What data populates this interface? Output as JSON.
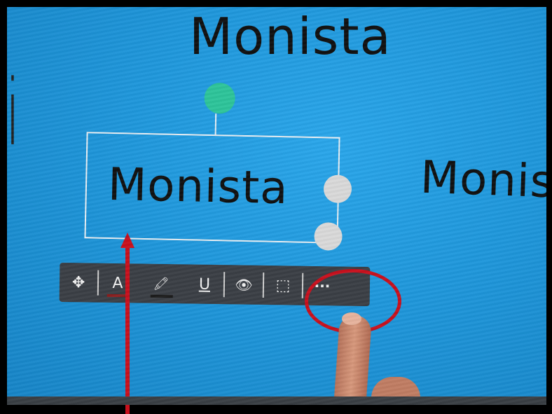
{
  "canvas_words": {
    "top": "Monista",
    "left_fragment": "i",
    "right": "Monis"
  },
  "selected_text": "Monista",
  "toolbar": {
    "buttons": [
      {
        "name": "move",
        "icon": "✥"
      },
      {
        "name": "text-color",
        "icon": "A"
      },
      {
        "name": "highlight",
        "icon": "🖍"
      },
      {
        "name": "underline",
        "icon": "U"
      },
      {
        "name": "visibility",
        "icon": "👁"
      },
      {
        "name": "crop",
        "icon": "⬚"
      },
      {
        "name": "more-options",
        "icon": "···"
      }
    ]
  },
  "colors": {
    "annotation_red": "#c8101d",
    "rotate_handle": "#2dc49a",
    "toolbar_bg": "#3b3f45",
    "screen_blue": "#1f97db"
  }
}
